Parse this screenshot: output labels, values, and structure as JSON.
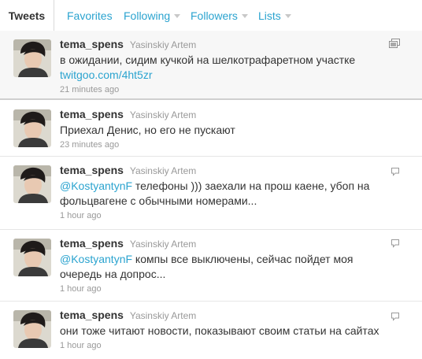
{
  "tabs": [
    {
      "label": "Tweets",
      "active": true,
      "caret": false
    },
    {
      "label": "Favorites",
      "active": false,
      "caret": false
    },
    {
      "label": "Following",
      "active": false,
      "caret": true
    },
    {
      "label": "Followers",
      "active": false,
      "caret": true
    },
    {
      "label": "Lists",
      "active": false,
      "caret": true
    }
  ],
  "tweets": [
    {
      "screen_name": "tema_spens",
      "full_name": "Yasinskiy Artem",
      "mention": "",
      "text": "в ожидании, сидим кучкой на шелкотрафаретном участке",
      "link": "twitgoo.com/4ht5zr",
      "time": "21 minutes ago",
      "icon": "photo-icon"
    },
    {
      "screen_name": "tema_spens",
      "full_name": "Yasinskiy Artem",
      "mention": "",
      "text": "Приехал Денис, но его не пускают",
      "link": "",
      "time": "23 minutes ago",
      "icon": ""
    },
    {
      "screen_name": "tema_spens",
      "full_name": "Yasinskiy Artem",
      "mention": "@KostyantynF",
      "text": " телефоны ))) заехали на прош каене, убоп на фольцвагене с обычными номерами...",
      "link": "",
      "time": "1 hour ago",
      "icon": "speech-bubble-icon"
    },
    {
      "screen_name": "tema_spens",
      "full_name": "Yasinskiy Artem",
      "mention": "@KostyantynF",
      "text": " компы все выключены, сейчас пойдет моя очередь на допрос...",
      "link": "",
      "time": "1 hour ago",
      "icon": "speech-bubble-icon"
    },
    {
      "screen_name": "tema_spens",
      "full_name": "Yasinskiy Artem",
      "mention": "",
      "text": "они тоже читают новости, показывают своим статьи на сайтах",
      "link": "",
      "time": "1 hour ago",
      "icon": "speech-bubble-icon"
    }
  ],
  "colors": {
    "link": "#2aa3cf",
    "meta": "#999999",
    "text": "#333333"
  }
}
